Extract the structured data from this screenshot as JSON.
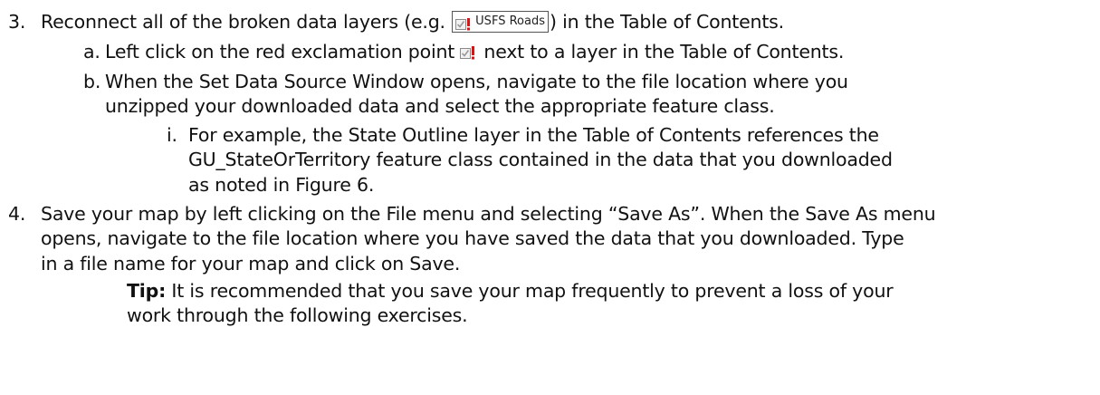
{
  "step3": {
    "number": "3.",
    "text_before": "Reconnect all of the broken data layers (e.g. ",
    "sample_layer_label": "USFS Roads",
    "text_after": ") in the Table of Contents.",
    "a": {
      "marker": "a.",
      "text_before": "Left click on the red exclamation point",
      "text_after": " next to a layer in the Table of Contents."
    },
    "b": {
      "marker": "b.",
      "line1": "When the Set Data Source Window opens, navigate to the file location where you",
      "line2": "unzipped your downloaded data and select the appropriate feature class."
    },
    "i": {
      "marker": "i.",
      "line1": "For example, the State Outline layer in the Table of Contents references the",
      "line2": "GU_StateOrTerritory feature class contained in the data that you downloaded",
      "line3": "as noted in Figure 6."
    }
  },
  "step4": {
    "number": "4.",
    "line1": "Save your map by left clicking on the File menu and selecting “Save As”. When the Save As menu",
    "line2": "opens, navigate to the file location where you have saved the data that you downloaded. Type",
    "line3": "in a file name for your map and click on Save."
  },
  "tip": {
    "label": "Tip:",
    "line1_rest": " It is recommended that you save your map frequently to prevent a loss of your",
    "line2": "work through the following exercises."
  },
  "icons": {
    "broken_layer_icon": "broken-data-source-icon"
  },
  "colors": {
    "text": "#111111",
    "icon_red": "#e01010",
    "icon_box": "#8a8a8a"
  }
}
